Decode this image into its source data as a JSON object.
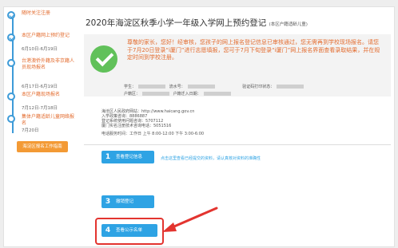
{
  "sidebar": {
    "steps": [
      {
        "title": "随时关注注册",
        "date": "",
        "done": true
      },
      {
        "title": "本区户籍网上预约登记",
        "date": "6月10日-6月19日",
        "done": true
      },
      {
        "title": "台港澳侨外籍及非京籍人员现场报名",
        "date": "6月17日-6月19日",
        "done": false
      },
      {
        "title": "本区户籍现场报名",
        "date": "7月12日-7月18日",
        "done": false
      },
      {
        "title": "集体户籍适龄儿童网络报名",
        "date": "7月20日",
        "done": false
      }
    ],
    "manual_button": "海淀区报名工作指南"
  },
  "main": {
    "title": "2020年海淀区秋季小学一年级入学网上预约登记",
    "title_note": "(本区户籍适龄儿童)",
    "notice": "尊敬的家长，您好！经审核，您孩子的网上报名登记信息已审核通过，您无需再到学校现场报名。请您于7月20日登录“i厦门”进行志愿填报，您可于7月下旬登录“i厦门”网上报名界面查看录取结果，并在规定时间到学校注册。",
    "info_labels": {
      "student": "学生：",
      "flow": "流水号：",
      "verify": "验证码打印状态：",
      "hukou_area": "户籍区：",
      "hukou_date": "户籍迁入日期："
    },
    "contact": {
      "line1": "海沧区人民政府网站：http://www.haicang.gov.cn",
      "line2": "入学政策咨询：8886887",
      "line3": "登记系统使用问题咨询：5707112",
      "line4": "厦门实名注册技术咨询电话：5051516",
      "line5": "电话服务时间：工作日 上午 8:00-12:00 下午 3:00-6:00"
    },
    "actions": [
      {
        "num": "1",
        "label": "查看登记信息"
      },
      {
        "num": "3",
        "label": "撤销登记"
      },
      {
        "num": "4",
        "label": "查看公示名单"
      }
    ],
    "action_note": "点击这里查看已经提交的资料，请认真核对资料的准确性"
  },
  "colors": {
    "accent_blue": "#2ea3e4",
    "orange": "#e36c2f",
    "check_green": "#61c15a",
    "highlight_red": "#e3342f"
  }
}
